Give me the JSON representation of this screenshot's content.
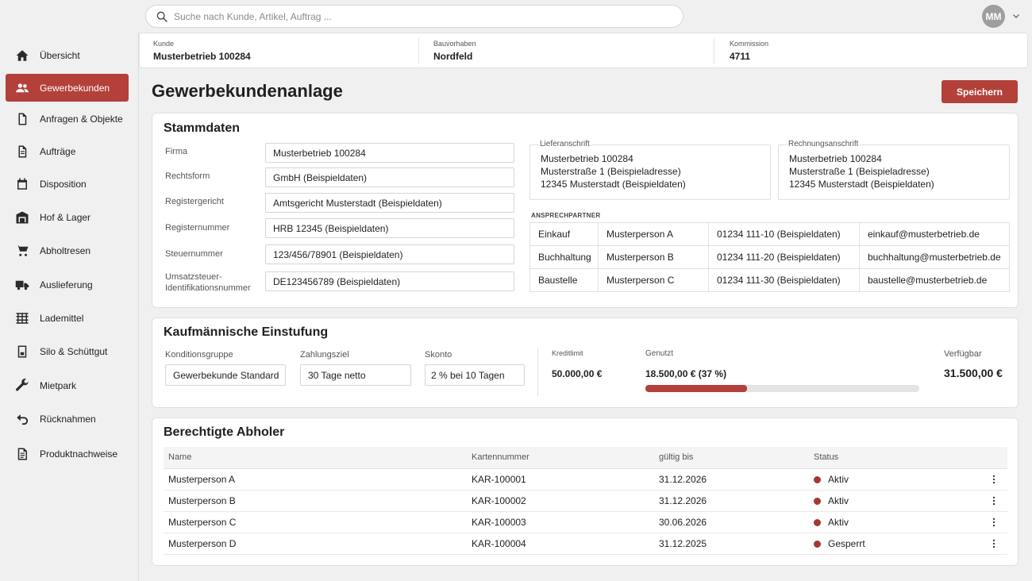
{
  "search": {
    "placeholder": "Suche nach Kunde, Artikel, Auftrag ..."
  },
  "user": {
    "initials": "MM"
  },
  "sidebar": {
    "items": [
      {
        "label": "Übersicht",
        "icon": "home-icon"
      },
      {
        "label": "Gewerbekunden",
        "icon": "users-icon",
        "active": true
      },
      {
        "label": "Anfragen & Objekte",
        "icon": "document-icon"
      },
      {
        "label": "Aufträge",
        "icon": "document-lines-icon"
      },
      {
        "label": "Disposition",
        "icon": "calendar-icon"
      },
      {
        "label": "Hof & Lager",
        "icon": "warehouse-icon"
      },
      {
        "label": "Abholtresen",
        "icon": "cart-icon"
      },
      {
        "label": "Auslieferung",
        "icon": "truck-icon"
      },
      {
        "label": "Lademittel",
        "icon": "pallet-icon"
      },
      {
        "label": "Silo & Schüttgut",
        "icon": "silo-icon"
      },
      {
        "label": "Mietpark",
        "icon": "wrench-icon"
      },
      {
        "label": "Rücknahmen",
        "icon": "return-arrow-icon"
      },
      {
        "label": "Produktnachweise",
        "icon": "document-list-icon"
      }
    ]
  },
  "context": {
    "kunde_label": "Kunde",
    "kunde": "Musterbetrieb 100284",
    "bauvorhaben_label": "Bauvorhaben",
    "bauvorhaben": "Nordfeld",
    "kommission_label": "Kommission",
    "kommission": "4711"
  },
  "page": {
    "title": "Gewerbekundenanlage",
    "save_label": "Speichern"
  },
  "stammdaten": {
    "title": "Stammdaten",
    "fields": [
      {
        "label": "Firma",
        "value": "Musterbetrieb 100284"
      },
      {
        "label": "Rechtsform",
        "value": "GmbH (Beispieldaten)"
      },
      {
        "label": "Registergericht",
        "value": "Amtsgericht Musterstadt (Beispieldaten)"
      },
      {
        "label": "Registernummer",
        "value": "HRB 12345 (Beispieldaten)"
      },
      {
        "label": "Steuernummer",
        "value": "123/456/78901 (Beispieldaten)"
      },
      {
        "label": "Umsatzsteuer-Identifikationsnummer",
        "label_line1": "Umsatzsteuer-",
        "label_line2": "Identifikationsnummer",
        "value": "DE123456789 (Beispieldaten)"
      }
    ],
    "lieferanschrift": {
      "label": "Lieferanschrift",
      "lines": [
        "Musterbetrieb 100284",
        "Musterstraße 1 (Beispieladresse)",
        "12345 Musterstadt (Beispieldaten)"
      ]
    },
    "rechnungsanschrift": {
      "label": "Rechnungsanschrift",
      "lines": [
        "Musterbetrieb 100284",
        "Musterstraße 1 (Beispieladresse)",
        "12345 Musterstadt (Beispieldaten)"
      ]
    },
    "ansprechpartner_title": "ANSPRECHPARTNER",
    "ansprechpartner": [
      {
        "bereich": "Einkauf",
        "name": "Musterperson A",
        "telefon": "01234 111-10 (Beispieldaten)",
        "email": "einkauf@musterbetrieb.de"
      },
      {
        "bereich": "Buchhaltung",
        "name": "Musterperson B",
        "telefon": "01234 111-20 (Beispieldaten)",
        "email": "buchhaltung@musterbetrieb.de"
      },
      {
        "bereich": "Baustelle",
        "name": "Musterperson C",
        "telefon": "01234 111-30 (Beispieldaten)",
        "email": "baustelle@musterbetrieb.de"
      }
    ]
  },
  "einstufung": {
    "title": "Kaufmännische Einstufung",
    "konditionsgruppe_label": "Konditionsgruppe",
    "konditionsgruppe": "Gewerbekunde Standard",
    "zahlungsziel_label": "Zahlungsziel",
    "zahlungsziel": "30 Tage netto",
    "skonto_label": "Skonto",
    "skonto": "2 % bei 10 Tagen",
    "kreditlimit_label": "Kreditlimit",
    "kreditlimit": "50.000,00 €",
    "genutzt_label": "Genutzt",
    "genutzt": "18.500,00 € (37 %)",
    "genutzt_percent": 37,
    "verfuegbar_label": "Verfügbar",
    "verfuegbar": "31.500,00 €",
    "accent_color": "#b3413a"
  },
  "abholer": {
    "title": "Berechtigte Abholer",
    "columns": [
      "Name",
      "Kartennummer",
      "gültig bis",
      "Status"
    ],
    "rows": [
      {
        "name": "Musterperson A",
        "karte": "KAR-100001",
        "gueltig": "31.12.2026",
        "status": "Aktiv"
      },
      {
        "name": "Musterperson B",
        "karte": "KAR-100002",
        "gueltig": "31.12.2026",
        "status": "Aktiv"
      },
      {
        "name": "Musterperson C",
        "karte": "KAR-100003",
        "gueltig": "30.06.2026",
        "status": "Aktiv"
      },
      {
        "name": "Musterperson D",
        "karte": "KAR-100004",
        "gueltig": "31.12.2025",
        "status": "Gesperrt"
      }
    ]
  }
}
